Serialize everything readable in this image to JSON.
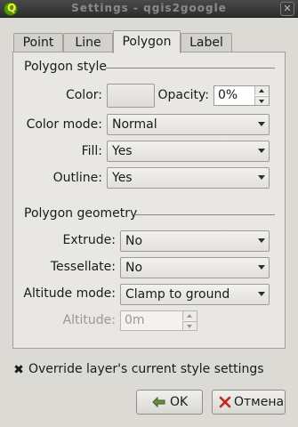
{
  "window": {
    "title": "Settings - qgis2google",
    "close_glyph": "✕"
  },
  "tabs": [
    {
      "label": "Point",
      "active": false
    },
    {
      "label": "Line",
      "active": false
    },
    {
      "label": "Polygon",
      "active": true
    },
    {
      "label": "Label",
      "active": false
    }
  ],
  "polygon_style": {
    "title": "Polygon style",
    "color_label": "Color:",
    "opacity_label": "Opacity:",
    "opacity_value": "0%",
    "color_mode_label": "Color mode:",
    "color_mode_value": "Normal",
    "fill_label": "Fill:",
    "fill_value": "Yes",
    "outline_label": "Outline:",
    "outline_value": "Yes"
  },
  "polygon_geometry": {
    "title": "Polygon geometry",
    "extrude_label": "Extrude:",
    "extrude_value": "No",
    "tessellate_label": "Tessellate:",
    "tessellate_value": "No",
    "altitude_mode_label": "Altitude mode:",
    "altitude_mode_value": "Clamp to ground",
    "altitude_label": "Altitude:",
    "altitude_value": "0m"
  },
  "override": {
    "checked": true,
    "check_glyph": "✖",
    "label": "Override layer's current style settings"
  },
  "buttons": {
    "ok": "OK",
    "cancel": "Отмена"
  }
}
